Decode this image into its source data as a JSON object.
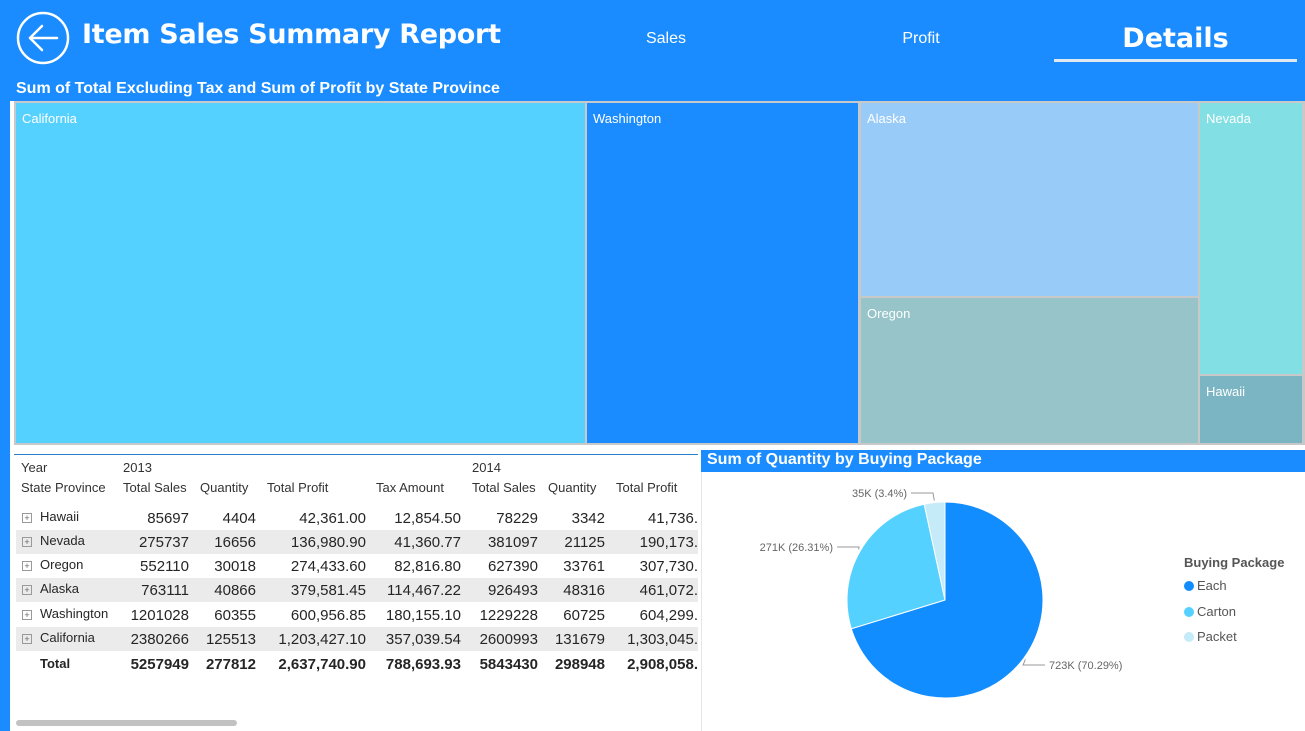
{
  "header": {
    "title": "Item Sales Summary Report",
    "tabs": [
      {
        "label": "Sales"
      },
      {
        "label": "Profit"
      },
      {
        "label": "Details"
      }
    ],
    "active_tab": "Details",
    "accent_color": "#1a8cff"
  },
  "treemap": {
    "title": "Sum of Total Excluding Tax and Sum of Profit by State Province",
    "tiles": [
      {
        "label": "California",
        "color": "#55d1ff"
      },
      {
        "label": "Washington",
        "color": "#1a8cff"
      },
      {
        "label": "Alaska",
        "color": "#99cbf9"
      },
      {
        "label": "Oregon",
        "color": "#96c4c9"
      },
      {
        "label": "Nevada",
        "color": "#82dfe4"
      },
      {
        "label": "Hawaii",
        "color": "#7bb5c4"
      }
    ]
  },
  "matrix": {
    "year_label": "Year",
    "row_header": "State Province",
    "years": [
      "2013",
      "2014"
    ],
    "columns_2013": [
      "Total Sales",
      "Quantity",
      "Total Profit",
      "Tax Amount"
    ],
    "columns_2014": [
      "Total Sales",
      "Quantity",
      "Total Profit"
    ],
    "rows": [
      {
        "state": "Hawaii",
        "c": [
          "85697",
          "4404",
          "42,361.00",
          "12,854.50",
          "78229",
          "3342",
          "41,736."
        ]
      },
      {
        "state": "Nevada",
        "c": [
          "275737",
          "16656",
          "136,980.90",
          "41,360.77",
          "381097",
          "21125",
          "190,173."
        ]
      },
      {
        "state": "Oregon",
        "c": [
          "552110",
          "30018",
          "274,433.60",
          "82,816.80",
          "627390",
          "33761",
          "307,730."
        ]
      },
      {
        "state": "Alaska",
        "c": [
          "763111",
          "40866",
          "379,581.45",
          "114,467.22",
          "926493",
          "48316",
          "461,072."
        ]
      },
      {
        "state": "Washington",
        "c": [
          "1201028",
          "60355",
          "600,956.85",
          "180,155.10",
          "1229228",
          "60725",
          "604,299."
        ]
      },
      {
        "state": "California",
        "c": [
          "2380266",
          "125513",
          "1,203,427.10",
          "357,039.54",
          "2600993",
          "131679",
          "1,303,045."
        ]
      }
    ],
    "total": {
      "label": "Total",
      "c": [
        "5257949",
        "277812",
        "2,637,740.90",
        "788,693.93",
        "5843430",
        "298948",
        "2,908,058."
      ]
    }
  },
  "chart_data": {
    "type": "pie",
    "title": "Sum of Quantity by Buying Package",
    "legend_title": "Buying Package",
    "legend_position": "right",
    "slices": [
      {
        "name": "Each",
        "value": 723000,
        "percent": 70.29,
        "label": "723K (70.29%)",
        "color": "#118dff"
      },
      {
        "name": "Carton",
        "value": 271000,
        "percent": 26.31,
        "label": "271K (26.31%)",
        "color": "#55d1ff"
      },
      {
        "name": "Packet",
        "value": 35000,
        "percent": 3.4,
        "label": "35K (3.4%)",
        "color": "#c5eaf8"
      }
    ]
  }
}
